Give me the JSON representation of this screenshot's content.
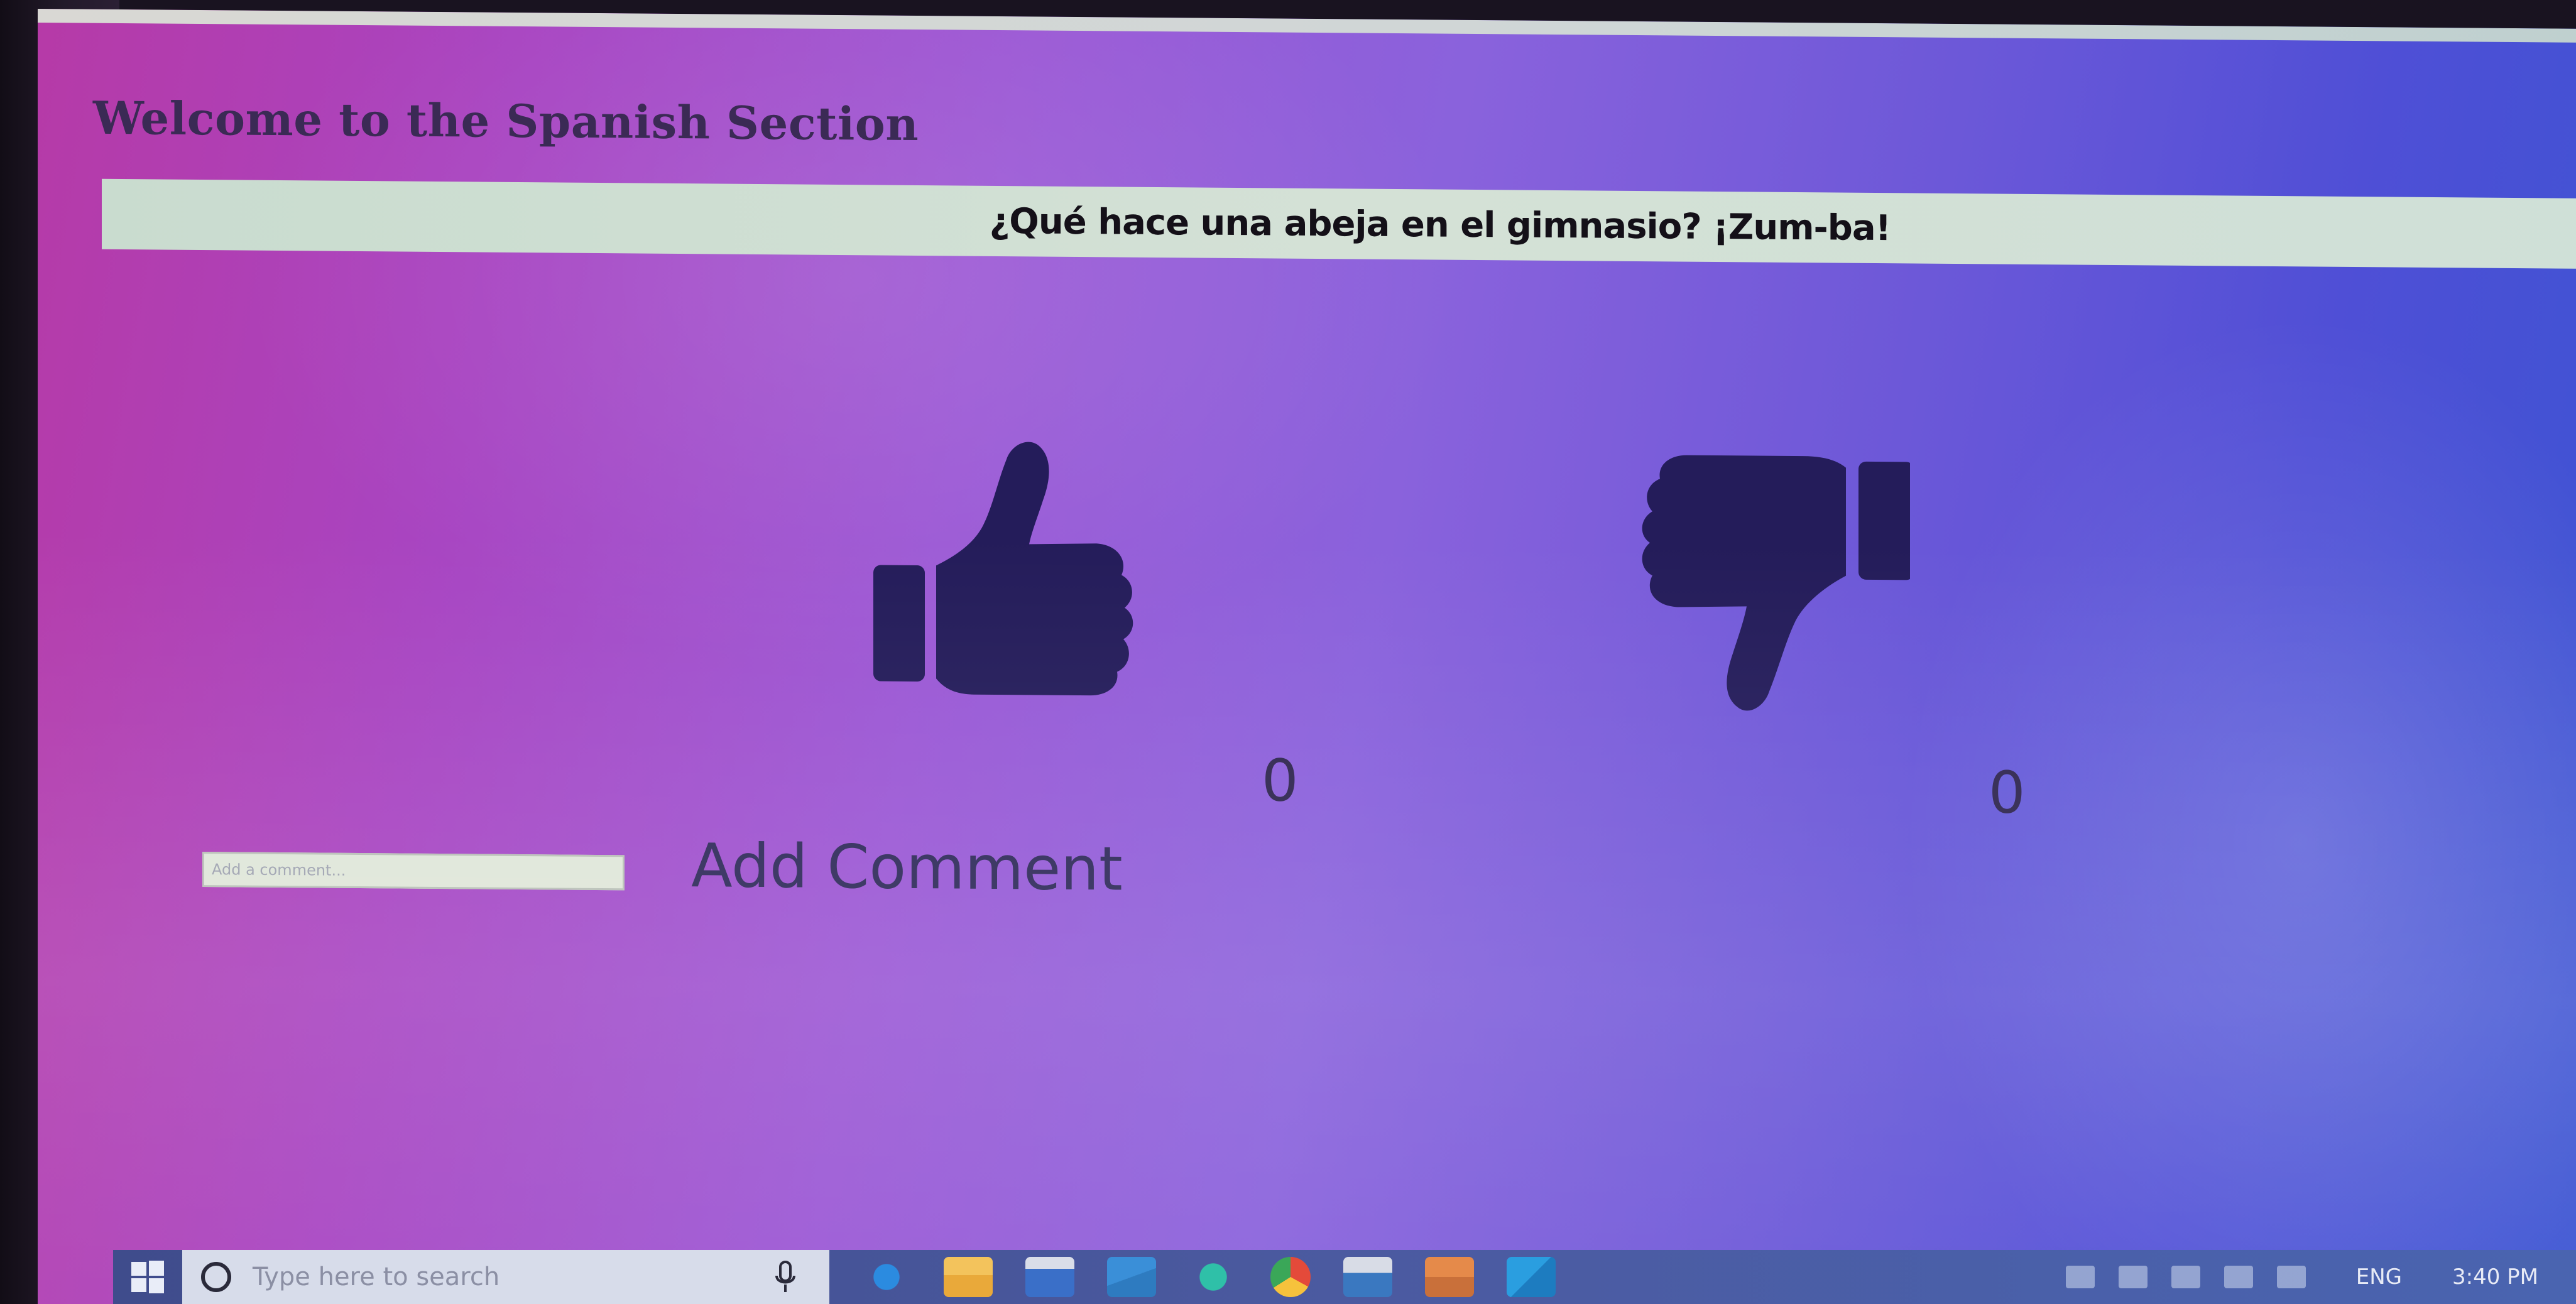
{
  "page": {
    "welcome_title": "Welcome to the Spanish Section",
    "joke": "¿Qué hace una abeja en el gimnasio? ¡Zum-ba!"
  },
  "votes": {
    "up_count": "0",
    "down_count": "0",
    "up_icon": "thumbs-up-icon",
    "down_icon": "thumbs-down-icon"
  },
  "comment": {
    "placeholder": "Add a comment...",
    "value": "",
    "button_label": "Add Comment"
  },
  "taskbar": {
    "search_placeholder": "Type here to search",
    "language": "ENG",
    "time": "3:40 PM",
    "icons": [
      "windows-start-icon",
      "search-icon",
      "microphone-icon",
      "edge-browser-icon",
      "file-explorer-icon",
      "store-icon",
      "mail-icon",
      "app-icon",
      "chrome-icon",
      "app-icon",
      "folder-icon",
      "vscode-icon"
    ]
  },
  "colors": {
    "icon_fill": "#241c5a",
    "joke_bar": "#d2e0d5",
    "taskbar": "#4a5aa0"
  }
}
